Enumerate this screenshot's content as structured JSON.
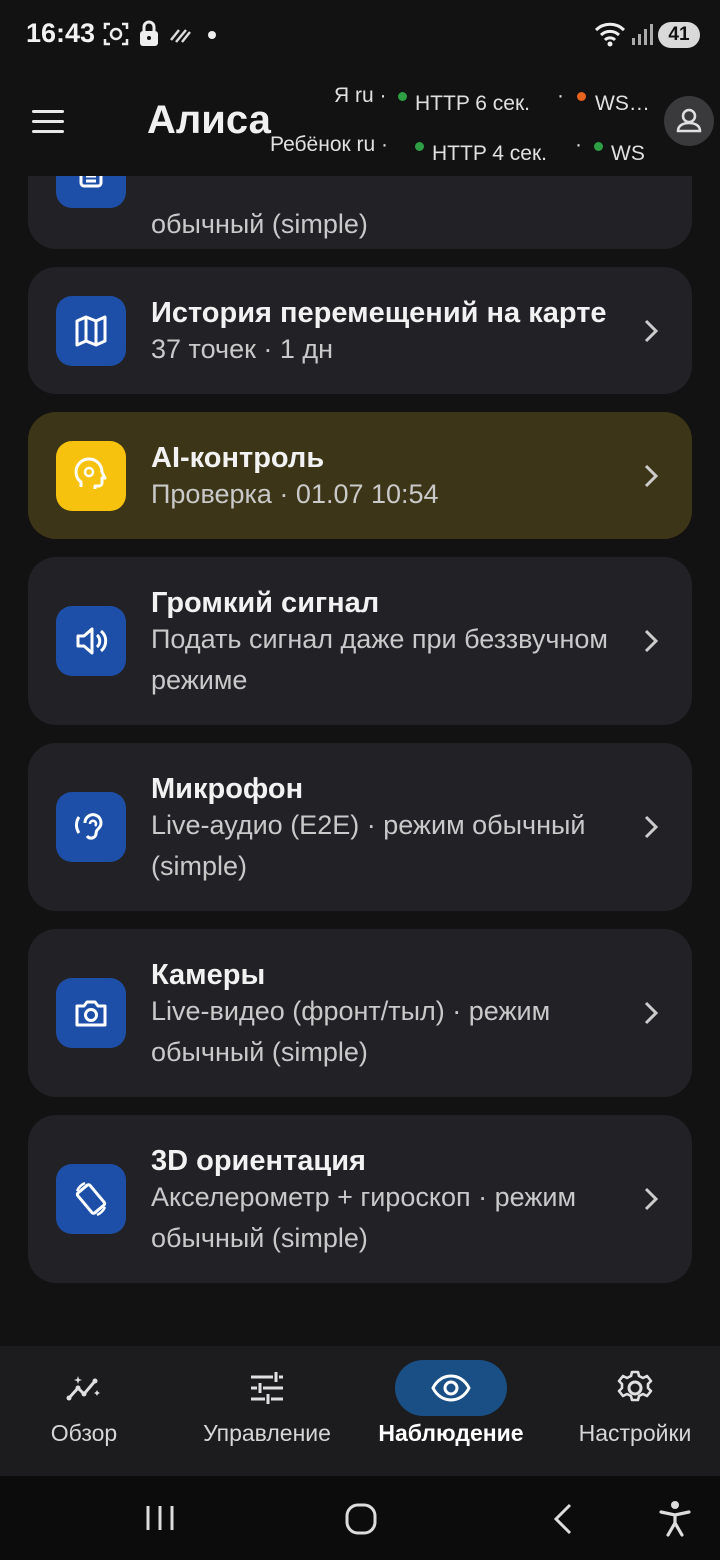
{
  "status_bar": {
    "time": "16:43",
    "battery": "41"
  },
  "header": {
    "title": "Алиса",
    "row1": {
      "label": "Я ru ·",
      "http": "HTTP 6 сек.",
      "sep": "·",
      "ws": "WS…",
      "http_dot_color": "#2e9e44",
      "ws_dot_color": "#e8641e"
    },
    "row2": {
      "label": "Ребёнок ru ·",
      "http": "HTTP 4 сек.",
      "sep": "·",
      "ws": "WS",
      "http_dot_color": "#2e9e44",
      "ws_dot_color": "#2e9e44"
    }
  },
  "cards": [
    {
      "title": "",
      "subtitle": "обычный (simple)",
      "icon": "document-icon"
    },
    {
      "title": "История перемещений на карте",
      "subtitle": "37 точек · 1 дн",
      "icon": "map-icon"
    },
    {
      "title": "AI-контроль",
      "subtitle": "Проверка · 01.07 10:54",
      "icon": "ai-brain-icon"
    },
    {
      "title": "Громкий сигнал",
      "subtitle": "Подать сигнал даже при беззвучном режиме",
      "icon": "speaker-icon"
    },
    {
      "title": "Микрофон",
      "subtitle": "Live-аудио (E2E) · режим обычный (simple)",
      "icon": "ear-icon"
    },
    {
      "title": "Камеры",
      "subtitle": "Live-видео (фронт/тыл) · режим обычный (simple)",
      "icon": "camera-icon"
    },
    {
      "title": "3D ориентация",
      "subtitle": "Акселерометр + гироскоп · режим обычный (simple)",
      "icon": "rotate-icon"
    }
  ],
  "bottom_nav": [
    {
      "label": "Обзор",
      "icon": "analytics-icon",
      "active": false
    },
    {
      "label": "Управление",
      "icon": "sliders-icon",
      "active": false
    },
    {
      "label": "Наблюдение",
      "icon": "eye-icon",
      "active": true
    },
    {
      "label": "Настройки",
      "icon": "gear-icon",
      "active": false
    }
  ],
  "colors": {
    "accent": "#1d4fa8",
    "active_tab": "#1a4f86",
    "ai_card": "#3d3517",
    "ai_icon": "#f6c20d"
  }
}
